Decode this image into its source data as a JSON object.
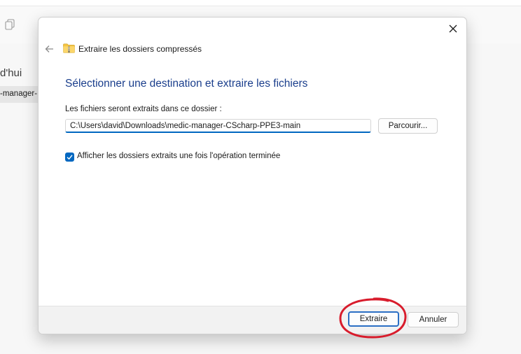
{
  "background": {
    "heading": "d'hui",
    "selected_item": "-manager-"
  },
  "dialog": {
    "title": "Extraire les dossiers compressés",
    "heading": "Sélectionner une destination et extraire les fichiers",
    "folder_label": "Les fichiers seront extraits dans ce dossier :",
    "path_value": "C:\\Users\\david\\Downloads\\medic-manager-CScharp-PPE3-main",
    "browse_label": "Parcourir...",
    "checkbox_label": "Afficher les dossiers extraits une fois l'opération terminée",
    "checkbox_checked": true,
    "extract_label": "Extraire",
    "cancel_label": "Annuler"
  },
  "colors": {
    "accent": "#0067c0",
    "heading": "#1a3e8c",
    "annotation": "#d81c2c"
  },
  "icons": {
    "close": "close-icon",
    "back": "back-arrow-icon",
    "zip_folder": "zip-folder-icon",
    "check": "checkmark-icon",
    "copy": "copy-icon"
  }
}
